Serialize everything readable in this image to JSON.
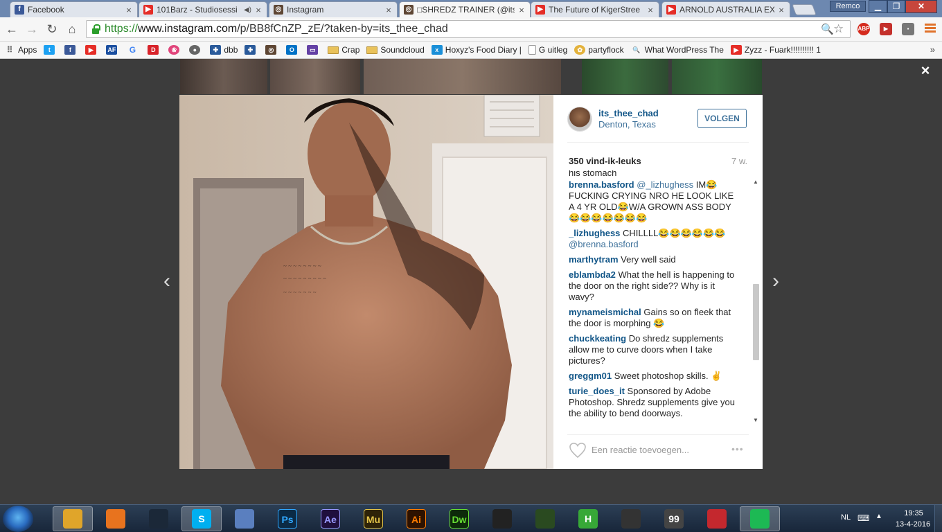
{
  "browser": {
    "tabs": [
      {
        "title": "Facebook",
        "icon": "facebook-icon",
        "active": false
      },
      {
        "title": "101Barz - Studiosessi",
        "icon": "youtube-icon",
        "active": false,
        "audio": true
      },
      {
        "title": "Instagram",
        "icon": "instagram-icon",
        "active": false
      },
      {
        "title": "□SHREDZ TRAINER (@its_",
        "icon": "instagram-icon",
        "active": true
      },
      {
        "title": "The Future of KigerStree",
        "icon": "youtube-icon",
        "active": false
      },
      {
        "title": "ARNOLD AUSTRALIA EXP",
        "icon": "youtube-icon",
        "active": false
      }
    ],
    "profile_name": "Remco",
    "url_scheme": "https://",
    "url_host": "www.instagram.com",
    "url_path": "/p/BB8fCnZP_zE/?taken-by=its_thee_chad",
    "bookmarks": [
      {
        "label": "Apps",
        "icon": "apps-grid-icon"
      },
      {
        "label": "",
        "icon": "twitter-icon"
      },
      {
        "label": "",
        "icon": "facebook-icon"
      },
      {
        "label": "",
        "icon": "youtube-icon"
      },
      {
        "label": "",
        "icon": "af-icon",
        "text": "AF"
      },
      {
        "label": "",
        "icon": "google-icon",
        "text": "G"
      },
      {
        "label": "",
        "icon": "d-icon",
        "text": "D"
      },
      {
        "label": "",
        "icon": "pink-icon"
      },
      {
        "label": "",
        "icon": "gray-circle-icon"
      },
      {
        "label": "dbb",
        "icon": "dbb-icon"
      },
      {
        "label": "",
        "icon": "puzzle-icon"
      },
      {
        "label": "",
        "icon": "instagram-icon"
      },
      {
        "label": "",
        "icon": "outlook-icon",
        "text": "O"
      },
      {
        "label": "",
        "icon": "twitch-icon"
      },
      {
        "label": "Crap",
        "icon": "folder-icon"
      },
      {
        "label": "Soundcloud",
        "icon": "folder-icon"
      },
      {
        "label": "Hoxyz's Food Diary | ",
        "icon": "blue-x-icon"
      },
      {
        "label": "G uitleg",
        "icon": "page-icon"
      },
      {
        "label": "partyflock",
        "icon": "partyflock-icon"
      },
      {
        "label": "What WordPress The",
        "icon": "search-page-icon"
      },
      {
        "label": "Zyzz - Fuark!!!!!!!!!! 1",
        "icon": "youtube-icon"
      }
    ],
    "bookmarks_more": "»"
  },
  "post": {
    "username": "its_thee_chad",
    "location": "Denton, Texas",
    "follow_label": "VOLGEN",
    "likes": "350 vind-ik-leuks",
    "age": "7 w.",
    "cut_off_text": "his stomach",
    "comments": [
      {
        "user": "brenna.basford",
        "mention": "@_lizhughess",
        "text": " IM😂FUCKING CRYING NRO HE LOOK LIKE A 4 YR OLD😂W/A GROWN ASS BODY😂😂😂😂😂😂😂",
        "after": ""
      },
      {
        "user": "_lizhughess",
        "mention": "",
        "text": " CHILLLL😂😂😂😂😂😂 ",
        "after": "@brenna.basford"
      },
      {
        "user": "marthytram",
        "mention": "",
        "text": " Very well said",
        "after": ""
      },
      {
        "user": "eblambda2",
        "mention": "",
        "text": " What the hell is happening to the door on the right side?? Why is it wavy?",
        "after": ""
      },
      {
        "user": "mynameismichal",
        "mention": "",
        "text": " Gains so on fleek that the door is morphing 😂",
        "after": ""
      },
      {
        "user": "chuckkeating",
        "mention": "",
        "text": " Do shredz supplements allow me to curve doors when I take pictures?",
        "after": ""
      },
      {
        "user": "greggm01",
        "mention": "",
        "text": " Sweet photoshop skills. ✌",
        "after": ""
      },
      {
        "user": "turie_does_it",
        "mention": "",
        "text": " Sponsored by Adobe Photoshop. Shredz supplements give you the ability to bend doorways.",
        "after": ""
      }
    ],
    "comment_placeholder": "Een reactie toevoegen...",
    "more_label": "•••"
  },
  "overlay": {
    "close_label": "×",
    "prev_label": "‹",
    "next_label": "›"
  },
  "taskbar": {
    "apps": [
      {
        "name": "chrome",
        "text": "",
        "color": "#e0a52a",
        "active": true
      },
      {
        "name": "firefox",
        "text": "",
        "color": "#e8731e"
      },
      {
        "name": "steam",
        "text": "",
        "color": "#1b2838"
      },
      {
        "name": "skype",
        "text": "S",
        "color": "#00aff0",
        "active": true
      },
      {
        "name": "network-manager",
        "text": "",
        "color": "#5a7fbf"
      },
      {
        "name": "photoshop",
        "text": "Ps",
        "color": "#0b2a45",
        "fg": "#31a8ff"
      },
      {
        "name": "after-effects",
        "text": "Ae",
        "color": "#1f0f3d",
        "fg": "#9999ff"
      },
      {
        "name": "muse",
        "text": "Mu",
        "color": "#2e2308",
        "fg": "#e3c44a"
      },
      {
        "name": "illustrator",
        "text": "Ai",
        "color": "#2e1200",
        "fg": "#ff7c00"
      },
      {
        "name": "dreamweaver",
        "text": "Dw",
        "color": "#0d2a0a",
        "fg": "#66dd33"
      },
      {
        "name": "video-editor",
        "text": "",
        "color": "#222"
      },
      {
        "name": "razer",
        "text": "",
        "color": "#2a4a20"
      },
      {
        "name": "h-app",
        "text": "H",
        "color": "#37a837"
      },
      {
        "name": "racing",
        "text": "",
        "color": "#333"
      },
      {
        "name": "99-app",
        "text": "99",
        "color": "#444"
      },
      {
        "name": "red-app",
        "text": "",
        "color": "#c4282e"
      },
      {
        "name": "spotify",
        "text": "",
        "color": "#1db954",
        "active": true
      }
    ],
    "lang": "NL",
    "time": "19:35",
    "date": "13-4-2016"
  }
}
